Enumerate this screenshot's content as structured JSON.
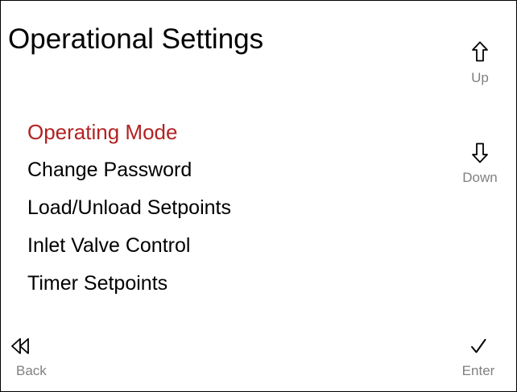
{
  "screen": {
    "title": "Operational Settings"
  },
  "menu": {
    "items": [
      {
        "label": "Operating Mode"
      },
      {
        "label": "Change Password"
      },
      {
        "label": "Load/Unload Setpoints"
      },
      {
        "label": "Inlet Valve Control"
      },
      {
        "label": "Timer Setpoints"
      }
    ],
    "selected_index": 0
  },
  "softkeys": {
    "up": {
      "label": "Up",
      "icon": "arrow-up-icon"
    },
    "down": {
      "label": "Down",
      "icon": "arrow-down-icon"
    },
    "back": {
      "label": "Back",
      "icon": "rewind-icon"
    },
    "enter": {
      "label": "Enter",
      "icon": "checkmark-icon"
    }
  },
  "colors": {
    "selected_text": "#b22222",
    "softkey_label": "#808080",
    "text": "#000000"
  }
}
